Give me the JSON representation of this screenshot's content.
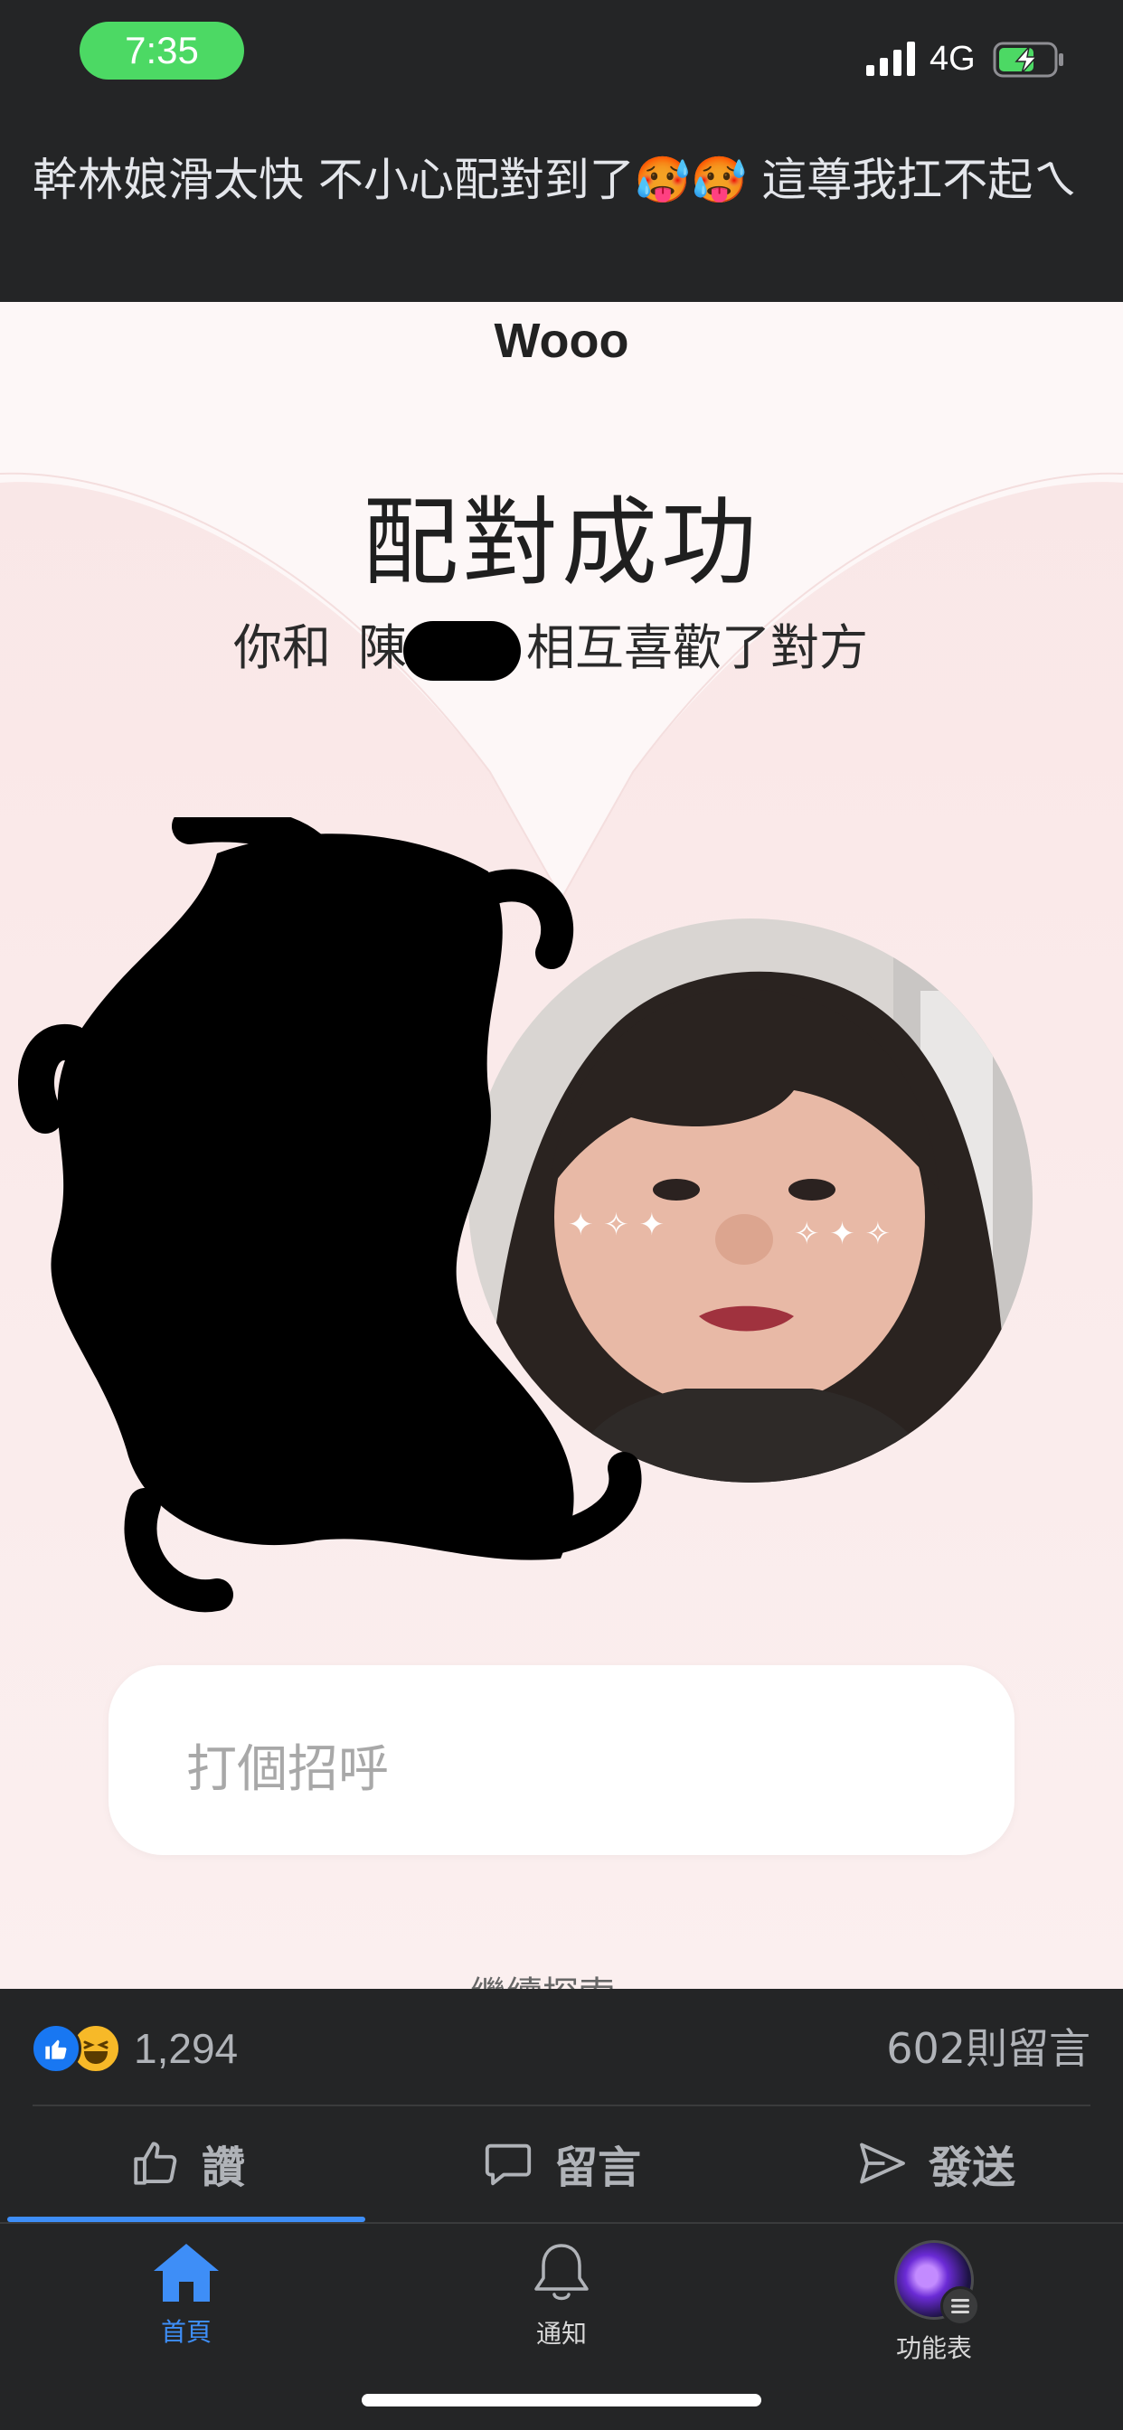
{
  "status_bar": {
    "time": "7:35",
    "network": "4G"
  },
  "post": {
    "caption": "幹林娘滑太快 不小心配對到了🥵🥵 這尊我扛不起ㄟ"
  },
  "shared_image": {
    "header": "Wooo",
    "title": "配對成功",
    "subtitle_prefix": "你和",
    "subtitle_name": "陳",
    "subtitle_suffix": "相互喜歡了對方",
    "message_placeholder": "打個招呼",
    "cut_off_text": "繼續探索"
  },
  "reactions": {
    "count": "1,294",
    "comments": "602則留言"
  },
  "actions": {
    "like": "讚",
    "comment": "留言",
    "share": "發送"
  },
  "tab_bar": {
    "home": "首頁",
    "notifications": "通知",
    "menu": "功能表"
  },
  "colors": {
    "accent": "#3e8ef7",
    "like_blue": "#1877f2",
    "status_green": "#4cd964",
    "background": "#242526"
  }
}
